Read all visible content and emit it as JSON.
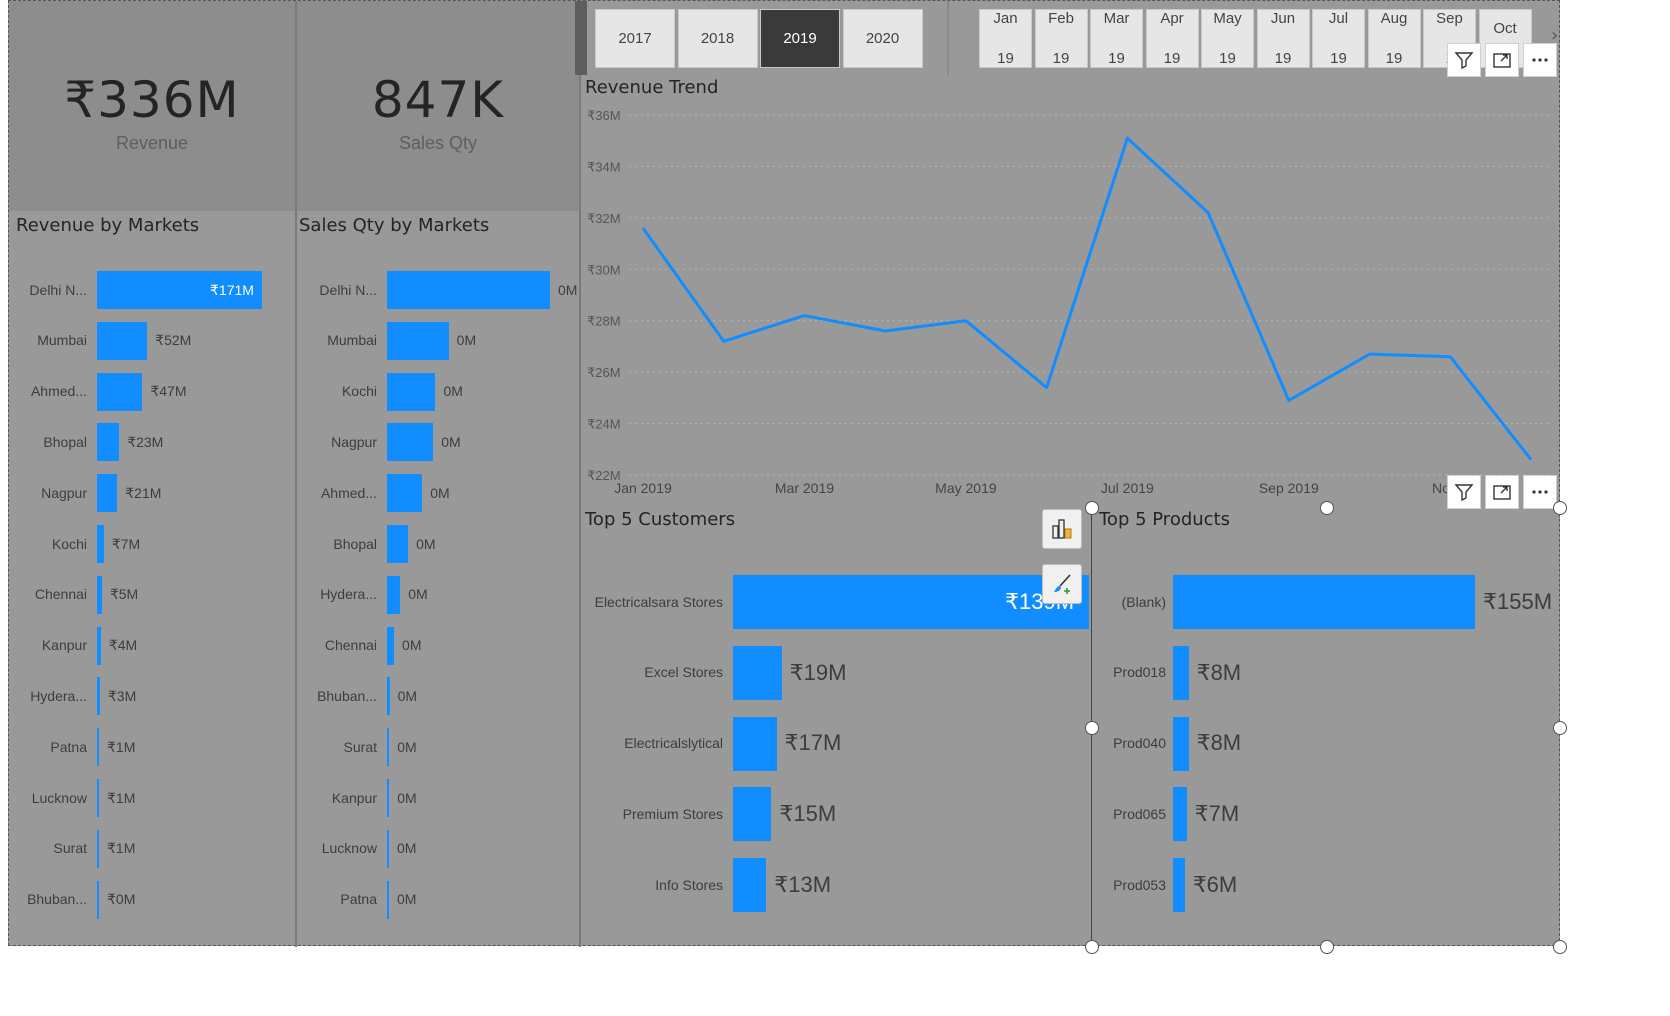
{
  "kpis": {
    "revenue": {
      "value": "₹336M",
      "label": "Revenue"
    },
    "sales_qty": {
      "value": "847K",
      "label": "Sales Qty"
    }
  },
  "year_slicer": {
    "options": [
      "2017",
      "2018",
      "2019",
      "2020"
    ],
    "selected": "2019"
  },
  "month_slicer": {
    "options": [
      {
        "month": "Jan",
        "year": "19"
      },
      {
        "month": "Feb",
        "year": "19"
      },
      {
        "month": "Mar",
        "year": "19"
      },
      {
        "month": "Apr",
        "year": "19"
      },
      {
        "month": "May",
        "year": "19"
      },
      {
        "month": "Jun",
        "year": "19"
      },
      {
        "month": "Jul",
        "year": "19"
      },
      {
        "month": "Aug",
        "year": "19"
      },
      {
        "month": "Sep",
        "year": "1"
      },
      {
        "month": "Oct",
        "year": ""
      }
    ],
    "next_icon": "chevron-right-icon"
  },
  "visual_header_icons": [
    "filter-icon",
    "focus-mode-icon",
    "more-options-icon"
  ],
  "floating_icons": [
    "format-visual-icon",
    "format-paint-icon"
  ],
  "colors": {
    "bar": "#118dff",
    "line": "#118dff",
    "canvas": "#999999",
    "kpi_bg": "#8d8d8d",
    "selected_slicer": "#3a3a3a"
  },
  "chart_data": [
    {
      "type": "bar",
      "orientation": "horizontal",
      "title": "Revenue by Markets",
      "categories": [
        "Delhi N...",
        "Mumbai",
        "Ahmed...",
        "Bhopal",
        "Nagpur",
        "Kochi",
        "Chennai",
        "Kanpur",
        "Hydera...",
        "Patna",
        "Lucknow",
        "Surat",
        "Bhuban..."
      ],
      "values": [
        171,
        52,
        47,
        23,
        21,
        7,
        5,
        4,
        3,
        1,
        1,
        1,
        0
      ],
      "labels": [
        "₹171M",
        "₹52M",
        "₹47M",
        "₹23M",
        "₹21M",
        "₹7M",
        "₹5M",
        "₹4M",
        "₹3M",
        "₹1M",
        "₹1M",
        "₹1M",
        "₹0M"
      ],
      "max": 171
    },
    {
      "type": "bar",
      "orientation": "horizontal",
      "title": "Sales Qty by Markets",
      "categories": [
        "Delhi N...",
        "Mumbai",
        "Kochi",
        "Nagpur",
        "Ahmed...",
        "Bhopal",
        "Hydera...",
        "Chennai",
        "Bhuban...",
        "Surat",
        "Kanpur",
        "Lucknow",
        "Patna"
      ],
      "values": [
        0.37,
        0.14,
        0.11,
        0.105,
        0.08,
        0.048,
        0.03,
        0.016,
        0.006,
        0.005,
        0.005,
        0.004,
        0.004
      ],
      "labels": [
        "0M",
        "0M",
        "0M",
        "0M",
        "0M",
        "0M",
        "0M",
        "0M",
        "0M",
        "0M",
        "0M",
        "0M",
        "0M"
      ],
      "max": 0.37
    },
    {
      "type": "line",
      "title": "Revenue Trend",
      "x": [
        "Jan 2019",
        "Feb 2019",
        "Mar 2019",
        "Apr 2019",
        "May 2019",
        "Jun 2019",
        "Jul 2019",
        "Aug 2019",
        "Sep 2019",
        "Oct 2019",
        "Nov 2019",
        "Dec 2019"
      ],
      "values": [
        31.6,
        27.2,
        28.2,
        27.6,
        28.0,
        25.4,
        35.1,
        32.2,
        24.9,
        26.7,
        26.6,
        22.6
      ],
      "ylim": [
        22,
        36
      ],
      "yticks": [
        "₹22M",
        "₹24M",
        "₹26M",
        "₹28M",
        "₹30M",
        "₹32M",
        "₹34M",
        "₹36M"
      ],
      "xticks": [
        "Jan 2019",
        "Mar 2019",
        "May 2019",
        "Jul 2019",
        "Sep 2019",
        "Nov 2"
      ],
      "grid": true
    },
    {
      "type": "bar",
      "orientation": "horizontal",
      "title": "Top 5 Customers",
      "categories": [
        "Electricalsara Stores",
        "Excel Stores",
        "Electricalslytical",
        "Premium Stores",
        "Info Stores"
      ],
      "values": [
        139,
        19,
        17,
        15,
        13
      ],
      "labels": [
        "₹139M",
        "₹19M",
        "₹17M",
        "₹15M",
        "₹13M"
      ],
      "max": 139
    },
    {
      "type": "bar",
      "orientation": "horizontal",
      "title": "Top 5 Products",
      "categories": [
        "(Blank)",
        "Prod018",
        "Prod040",
        "Prod065",
        "Prod053"
      ],
      "values": [
        155,
        8,
        8,
        7,
        6
      ],
      "labels": [
        "₹155M",
        "₹8M",
        "₹8M",
        "₹7M",
        "₹6M"
      ],
      "max": 155
    }
  ]
}
